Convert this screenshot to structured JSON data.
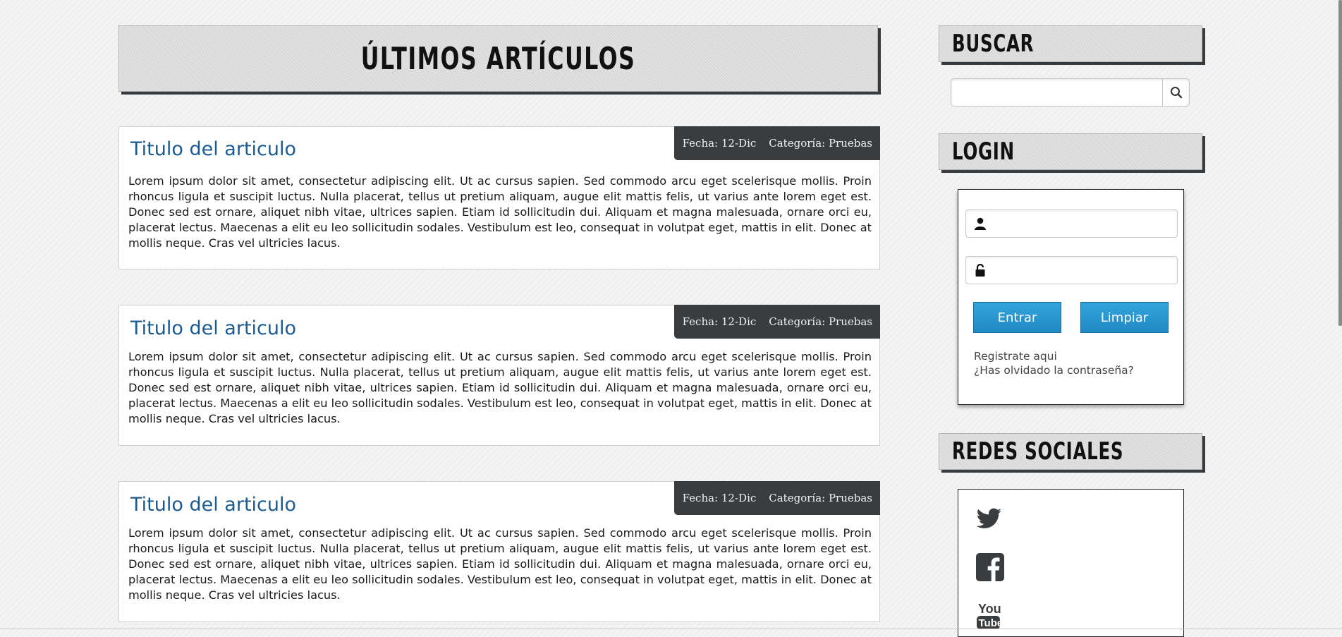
{
  "main": {
    "heading": "ÚLTIMOS ARTÍCULOS",
    "articles": [
      {
        "title": "Titulo del articulo",
        "date": "Fecha: 12-Dic",
        "category": "Categoría: Pruebas",
        "body": "Lorem ipsum dolor sit amet, consectetur adipiscing elit. Ut ac cursus sapien. Sed commodo arcu eget scelerisque mollis. Proin rhoncus ligula et suscipit luctus. Nulla placerat, tellus ut pretium aliquam, augue elit mattis felis, ut varius ante lorem eget est. Donec sed est ornare, aliquet nibh vitae, ultrices sapien. Etiam id sollicitudin dui. Aliquam et magna malesuada, ornare orci eu, placerat lectus. Maecenas a elit eu leo sollicitudin sodales. Vestibulum est leo, consequat in volutpat eget, mattis in elit. Donec at mollis neque. Cras vel ultricies lacus."
      },
      {
        "title": "Titulo del articulo",
        "date": "Fecha: 12-Dic",
        "category": "Categoría: Pruebas",
        "body": "Lorem ipsum dolor sit amet, consectetur adipiscing elit. Ut ac cursus sapien. Sed commodo arcu eget scelerisque mollis. Proin rhoncus ligula et suscipit luctus. Nulla placerat, tellus ut pretium aliquam, augue elit mattis felis, ut varius ante lorem eget est. Donec sed est ornare, aliquet nibh vitae, ultrices sapien. Etiam id sollicitudin dui. Aliquam et magna malesuada, ornare orci eu, placerat lectus. Maecenas a elit eu leo sollicitudin sodales. Vestibulum est leo, consequat in volutpat eget, mattis in elit. Donec at mollis neque. Cras vel ultricies lacus."
      },
      {
        "title": "Titulo del articulo",
        "date": "Fecha: 12-Dic",
        "category": "Categoría: Pruebas",
        "body": "Lorem ipsum dolor sit amet, consectetur adipiscing elit. Ut ac cursus sapien. Sed commodo arcu eget scelerisque mollis. Proin rhoncus ligula et suscipit luctus. Nulla placerat, tellus ut pretium aliquam, augue elit mattis felis, ut varius ante lorem eget est. Donec sed est ornare, aliquet nibh vitae, ultrices sapien. Etiam id sollicitudin dui. Aliquam et magna malesuada, ornare orci eu, placerat lectus. Maecenas a elit eu leo sollicitudin sodales. Vestibulum est leo, consequat in volutpat eget, mattis in elit. Donec at mollis neque. Cras vel ultricies lacus."
      }
    ]
  },
  "sidebar": {
    "search": {
      "heading": "BUSCAR",
      "placeholder": "",
      "value": "",
      "button_icon": "search-icon"
    },
    "login": {
      "heading": "LOGIN",
      "username_icon": "user-icon",
      "username_value": "",
      "password_icon": "lock-icon",
      "password_value": "",
      "submit_label": "Entrar",
      "clear_label": "Limpiar",
      "register_link": "Registrate aqui",
      "forgot_link": "¿Has olvidado la contraseña?"
    },
    "social": {
      "heading": "REDES SOCIALES",
      "icons": [
        "twitter-icon",
        "facebook-icon",
        "youtube-icon"
      ]
    }
  },
  "colors": {
    "title_blue": "#1b5b92",
    "meta_bg": "#3a3d3f",
    "button_blue": "#2a98d0",
    "header_gray": "#d8d8d8"
  }
}
